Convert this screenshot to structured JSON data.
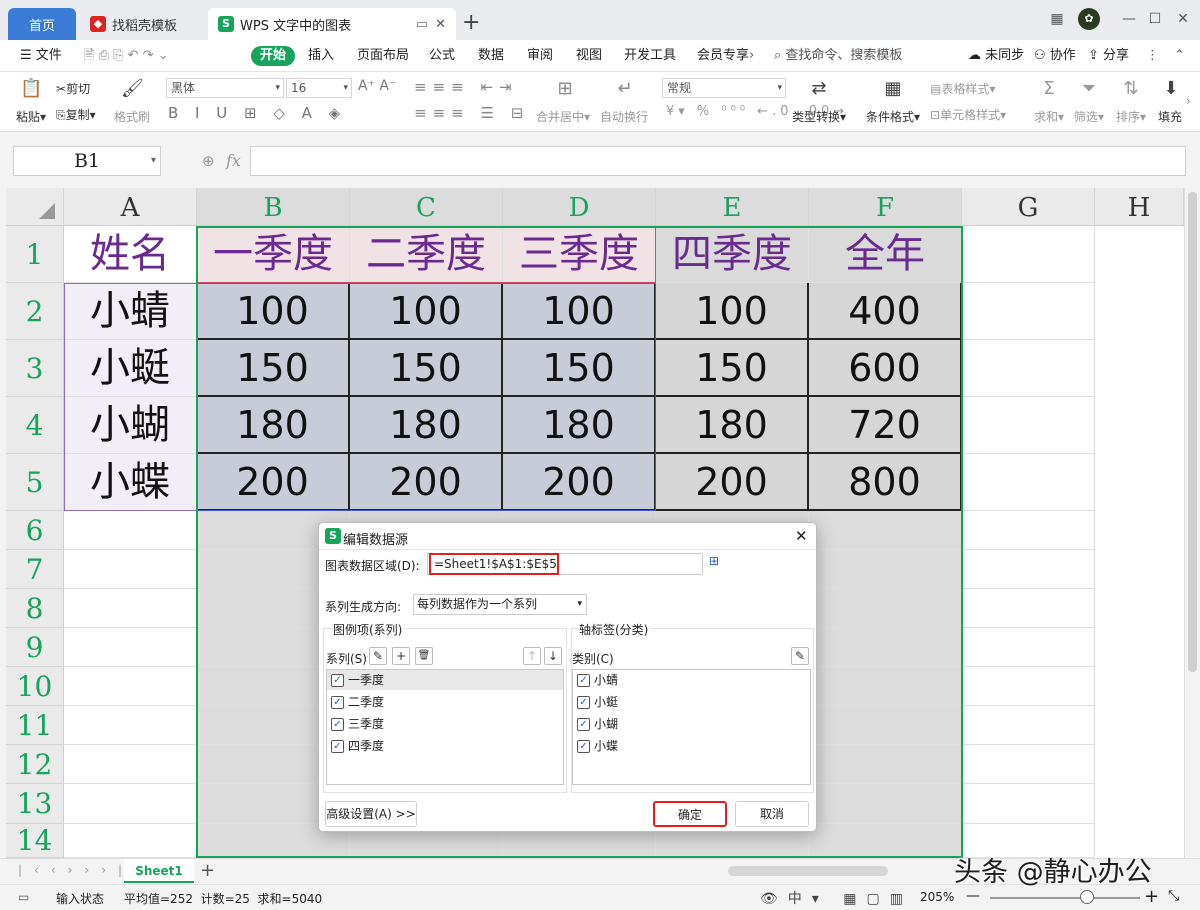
{
  "tabs": {
    "home": "首页",
    "docer": "找稻壳模板",
    "doc": "WPS 文字中的图表"
  },
  "menu": {
    "file": "文件",
    "items": [
      "开始",
      "插入",
      "页面布局",
      "公式",
      "数据",
      "审阅",
      "视图",
      "开发工具",
      "会员专享"
    ],
    "search": "查找命令、搜索模板",
    "unsynced": "未同步",
    "collab": "协作",
    "share": "分享"
  },
  "ribbon": {
    "paste": "粘贴",
    "cut": "剪切",
    "copy": "复制",
    "format_painter": "格式刷",
    "font": "黑体",
    "size": "16",
    "merge": "合并居中",
    "wrap": "自动换行",
    "numfmt": "常规",
    "convert": "类型转换",
    "cond": "条件格式",
    "table_style": "表格样式",
    "cell_style": "单元格样式",
    "sum": "求和",
    "filter": "筛选",
    "sort": "排序",
    "fill": "填充"
  },
  "namebox": "B1",
  "fx": "fx",
  "columns": [
    "A",
    "B",
    "C",
    "D",
    "E",
    "F",
    "G",
    "H"
  ],
  "rows": [
    "1",
    "2",
    "3",
    "4",
    "5",
    "6",
    "7",
    "8",
    "9",
    "10",
    "11",
    "12",
    "13",
    "14"
  ],
  "table": [
    [
      "姓名",
      "一季度",
      "二季度",
      "三季度",
      "四季度",
      "全年"
    ],
    [
      "小蜻",
      "100",
      "100",
      "100",
      "100",
      "400"
    ],
    [
      "小蜓",
      "150",
      "150",
      "150",
      "150",
      "600"
    ],
    [
      "小蝴",
      "180",
      "180",
      "180",
      "180",
      "720"
    ],
    [
      "小蝶",
      "200",
      "200",
      "200",
      "200",
      "800"
    ]
  ],
  "sheet": {
    "tab": "Sheet1"
  },
  "status": {
    "mode": "输入状态",
    "stats": "平均值=252  计数=25  求和=5040",
    "zoom": "205%"
  },
  "watermark": "头条 @静心办公",
  "dialog": {
    "title": "编辑数据源",
    "range_label": "图表数据区域(D):",
    "range_value": "=Sheet1!$A$1:$E$5",
    "direction_label": "系列生成方向:",
    "direction_value": "每列数据作为一个系列",
    "legend_group": "图例项(系列)",
    "series_label": "系列(S)",
    "axis_group": "轴标签(分类)",
    "category_label": "类别(C)",
    "series": [
      "一季度",
      "二季度",
      "三季度",
      "四季度"
    ],
    "categories": [
      "小蜻",
      "小蜓",
      "小蝴",
      "小蝶"
    ],
    "advanced": "高级设置(A) >>",
    "ok": "确定",
    "cancel": "取消"
  }
}
